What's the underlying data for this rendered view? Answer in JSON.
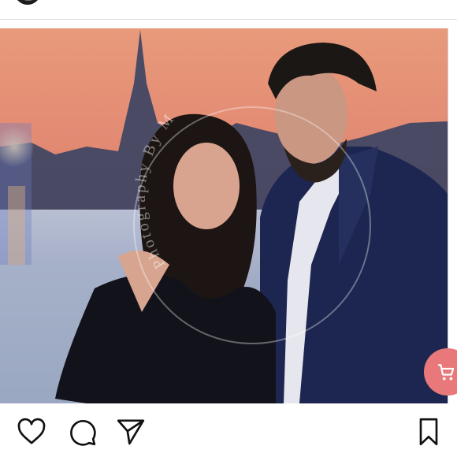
{
  "post": {
    "watermark_text": "Photography By M",
    "image_description_colors": {
      "sky_top": "#e7a07e",
      "sky_mid": "#e48a72",
      "skyline": "#3a3f5c",
      "water": "#7f93b8",
      "suit": "#1f2a52",
      "dress": "#14131d",
      "skin": "#d9a38b",
      "hair": "#1b1512"
    }
  },
  "actions": {
    "like_icon": "heart-icon",
    "comment_icon": "comment-icon",
    "share_icon": "send-icon",
    "save_icon": "bookmark-icon",
    "cart_icon": "shopping-cart-icon"
  },
  "colors": {
    "cart_badge": "#e8787a",
    "icon_stroke": "#111111"
  }
}
